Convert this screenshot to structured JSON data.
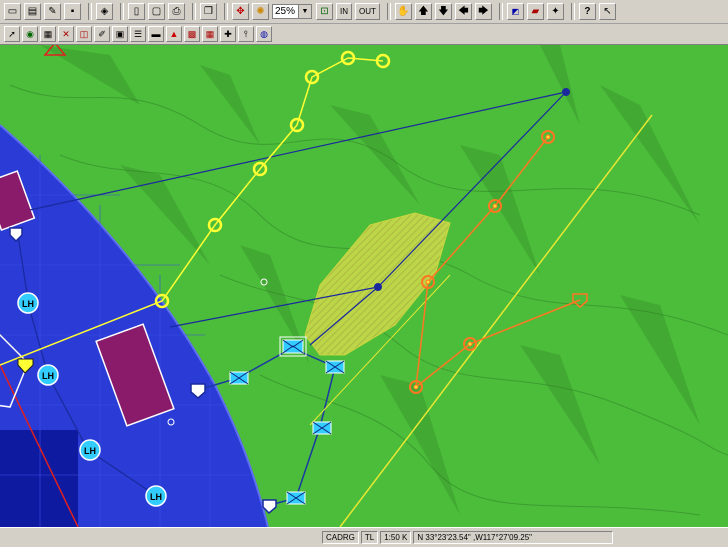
{
  "toolbar": {
    "zoom_value": "25%",
    "zoom_in_label": "IN",
    "zoom_out_label": "OUT",
    "help_label": "?"
  },
  "map": {
    "unit_labels": [
      "LH",
      "LH",
      "LH",
      "LH"
    ]
  },
  "statusbar": {
    "map_type": "CADRG",
    "map_datum": "TL",
    "scale": "1:50 K",
    "coordinates": "N 33°23'23.54\" ,W117°27'09.25\""
  },
  "colors": {
    "ocean": "#2a3bd6",
    "land": "#4bbd3a",
    "yellow_route": "#ffff33",
    "orange_route": "#ff7722",
    "blue_line": "#1a2a9c",
    "magenta_zone": "#8a1a6a"
  }
}
